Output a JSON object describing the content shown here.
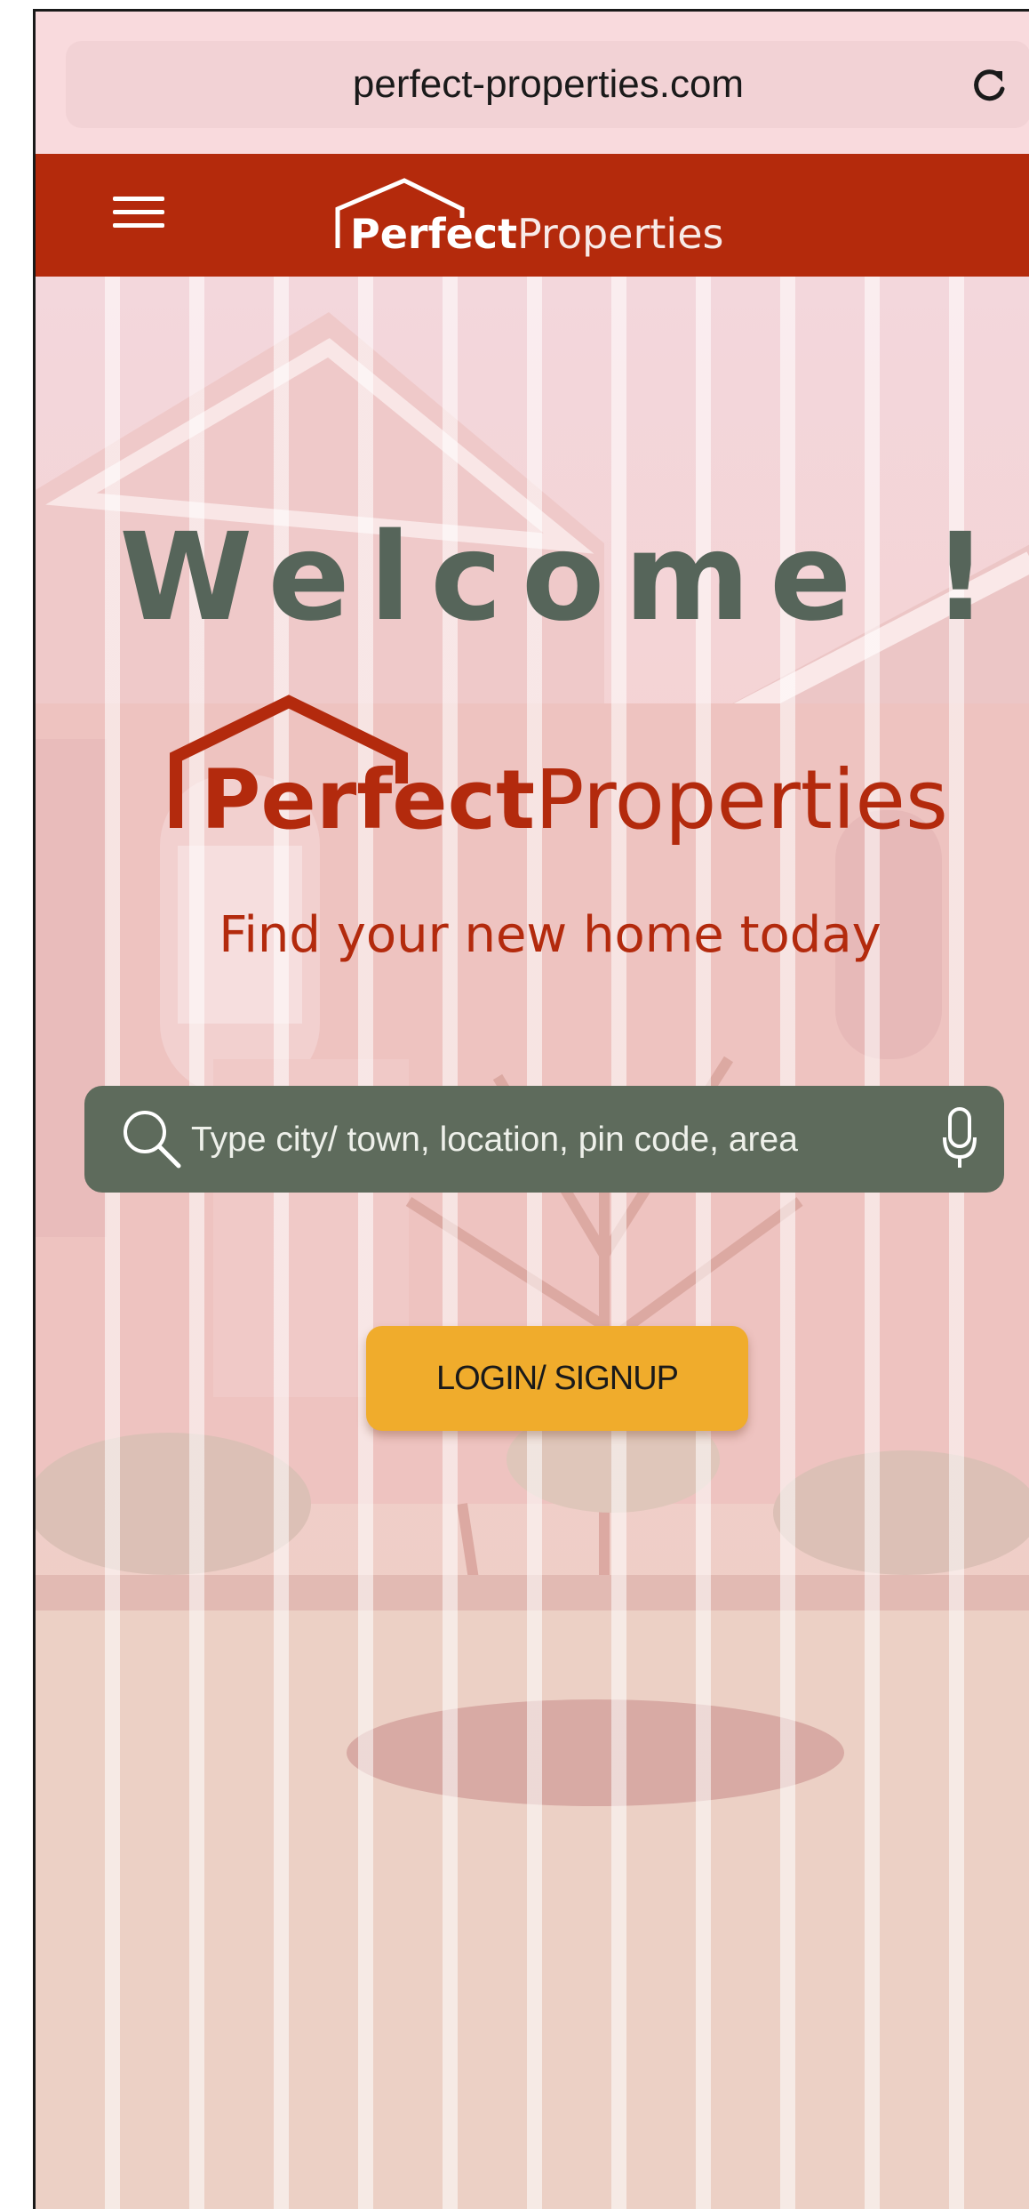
{
  "browser": {
    "url": "perfect-properties.com"
  },
  "brand": {
    "bold": "Perfect",
    "light": "Properties"
  },
  "hero": {
    "welcome": "Welcome !",
    "tagline": "Find your new home today"
  },
  "search": {
    "placeholder": "Type city/ town, location, pin code, area"
  },
  "login": {
    "label": "LOGIN/ SIGNUP"
  },
  "icons": {
    "menu": "hamburger-menu-icon",
    "reload": "reload-icon",
    "search": "magnifier-search-icon",
    "mic": "microphone-icon",
    "logo": "house-roof-logo"
  },
  "colors": {
    "brand_red": "#b42a0c",
    "search_bar": "#5e6b5c",
    "welcome_text": "#56655a",
    "login_button": "#f0ac2c",
    "overlay_pink": "#f7d9dc"
  }
}
